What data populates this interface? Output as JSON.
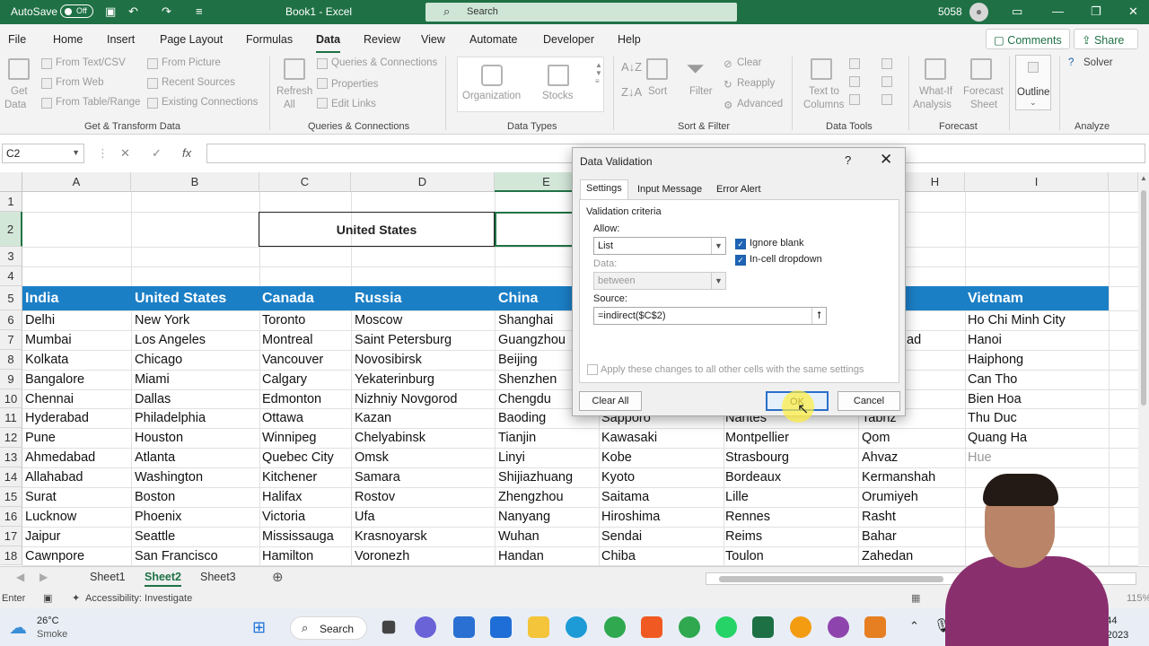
{
  "titlebar": {
    "autosave": "AutoSave",
    "toggle": "Off",
    "file_title": "Book1 - Excel",
    "search_placeholder": "Search",
    "user_count": "5058"
  },
  "menu": {
    "items": [
      "File",
      "Home",
      "Insert",
      "Page Layout",
      "Formulas",
      "Data",
      "Review",
      "View",
      "Automate",
      "Developer",
      "Help"
    ],
    "comments": "Comments",
    "share": "Share"
  },
  "ribbon": {
    "get_data": "Get",
    "get_data2": "Data",
    "from_text": "From Text/CSV",
    "from_web": "From Web",
    "from_table": "From Table/Range",
    "from_picture": "From Picture",
    "recent_sources": "Recent Sources",
    "existing_connections": "Existing Connections",
    "group_get": "Get & Transform Data",
    "refresh": "Refresh",
    "refresh2": "All",
    "queries": "Queries & Connections",
    "properties": "Properties",
    "edit_links": "Edit Links",
    "group_queries": "Queries & Connections",
    "organization": "Organization",
    "stocks": "Stocks",
    "group_types": "Data Types",
    "sort": "Sort",
    "filter": "Filter",
    "clear": "Clear",
    "reapply": "Reapply",
    "advanced": "Advanced",
    "group_sort": "Sort & Filter",
    "text_to": "Text to",
    "columns": "Columns",
    "group_tools": "Data Tools",
    "whatif": "What-If",
    "analysis": "Analysis",
    "forecast": "Forecast",
    "sheet": "Sheet",
    "group_forecast": "Forecast",
    "outline": "Outline",
    "solver": "Solver",
    "group_analyze": "Analyze"
  },
  "formula": {
    "namebox": "C2",
    "fx": "fx"
  },
  "columns": [
    "A",
    "B",
    "C",
    "D",
    "E",
    "H",
    "I"
  ],
  "rows": [
    "1",
    "2",
    "3",
    "4",
    "5",
    "6",
    "7",
    "8",
    "9",
    "10",
    "11",
    "12",
    "13",
    "14",
    "15",
    "16",
    "17",
    "18"
  ],
  "selected_value": "United States",
  "headers": {
    "A": "India",
    "B": "United States",
    "C": "Canada",
    "D": "Russia",
    "E": "China",
    "I": "Vietnam"
  },
  "data": {
    "A": [
      "Delhi",
      "Mumbai",
      "Kolkata",
      "Bangalore",
      "Chennai",
      "Hyderabad",
      "Pune",
      "Ahmedabad",
      "Allahabad",
      "Surat",
      "Lucknow",
      "Jaipur",
      "Cawnpore"
    ],
    "B": [
      "New York",
      "Los Angeles",
      "Chicago",
      "Miami",
      "Dallas",
      "Philadelphia",
      "Houston",
      "Atlanta",
      "Washington",
      "Boston",
      "Phoenix",
      "Seattle",
      "San Francisco"
    ],
    "C": [
      "Toronto",
      "Montreal",
      "Vancouver",
      "Calgary",
      "Edmonton",
      "Ottawa",
      "Winnipeg",
      "Quebec City",
      "Kitchener",
      "Halifax",
      "Victoria",
      "Mississauga",
      "Hamilton"
    ],
    "D": [
      "Moscow",
      "Saint Petersburg",
      "Novosibirsk",
      "Yekaterinburg",
      "Nizhniy Novgorod",
      "Kazan",
      "Chelyabinsk",
      "Omsk",
      "Samara",
      "Rostov",
      "Ufa",
      "Krasnoyarsk",
      "Voronezh"
    ],
    "E": [
      "Shanghai",
      "Guangzhou",
      "Beijing",
      "Shenzhen",
      "Chengdu",
      "Baoding",
      "Tianjin",
      "Linyi",
      "Shijiazhuang",
      "Zhengzhou",
      "Nanyang",
      "Wuhan",
      "Handan"
    ],
    "F": [
      "Sapporo",
      "Kawasaki",
      "Kobe",
      "Kyoto",
      "Saitama",
      "Hiroshima",
      "Sendai",
      "Chiba"
    ],
    "G": [
      "Nantes",
      "Montpellier",
      "Strasbourg",
      "Bordeaux",
      "Lille",
      "Rennes",
      "Reims",
      "Toulon"
    ],
    "H": [
      "Tabriz",
      "Qom",
      "Ahvaz",
      "Kermanshah",
      "Orumiyeh",
      "Rasht",
      "Bahar",
      "Zahedan"
    ],
    "H_partial": "ad",
    "I": [
      "Ho Chi Minh City",
      "Hanoi",
      "Haiphong",
      "Can Tho",
      "Bien Hoa",
      "Thu Duc",
      "Quang Ha",
      "Hue"
    ]
  },
  "dialog": {
    "title": "Data Validation",
    "help": "?",
    "close": "✕",
    "tabs": [
      "Settings",
      "Input Message",
      "Error Alert"
    ],
    "criteria": "Validation criteria",
    "allow_label": "Allow:",
    "allow_value": "List",
    "data_label": "Data:",
    "data_value": "between",
    "ignore_blank": "Ignore blank",
    "in_cell": "In-cell dropdown",
    "source_label": "Source:",
    "source_value": "=indirect($C$2)",
    "apply_all": "Apply these changes to all other cells with the same settings",
    "clear_all": "Clear All",
    "ok": "OK",
    "cancel": "Cancel"
  },
  "sheets": [
    "Sheet1",
    "Sheet2",
    "Sheet3"
  ],
  "status": {
    "mode": "Enter",
    "accessibility": "Accessibility: Investigate",
    "zoom": "115%"
  },
  "taskbar": {
    "temp": "26°C",
    "weather": "Smoke",
    "search": "Search",
    "lang1": "EN",
    "lang2": "IN",
    "time": "00:44",
    "date": "04-02-2023"
  }
}
